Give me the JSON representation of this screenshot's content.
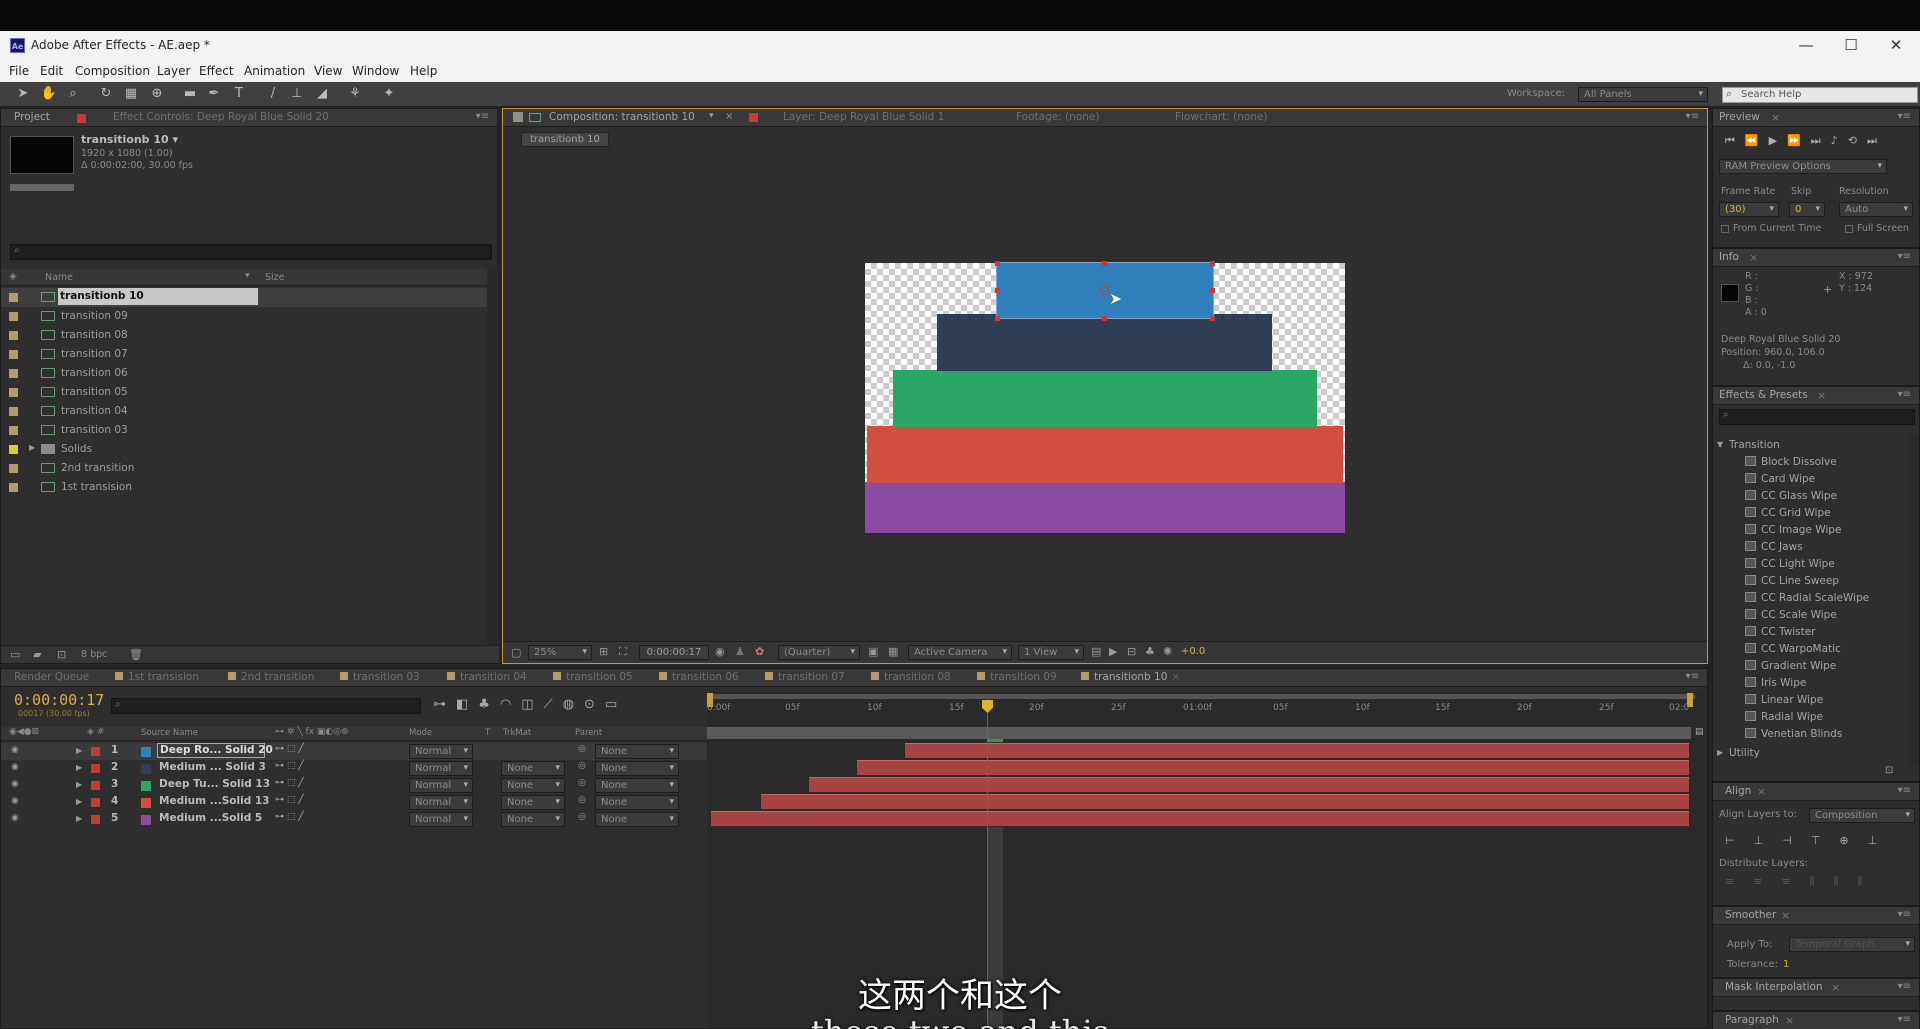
{
  "window": {
    "title": "Adobe After Effects - AE.aep *",
    "app_icon": "Ae"
  },
  "menu": [
    "File",
    "Edit",
    "Composition",
    "Layer",
    "Effect",
    "Animation",
    "View",
    "Window",
    "Help"
  ],
  "workspace": {
    "label": "Workspace:",
    "value": "All Panels"
  },
  "search_help": "Search Help",
  "project": {
    "tab_project": "Project",
    "tab_effects": "Effect Controls: Deep Royal Blue Solid 20",
    "item_name": "transitionb 10 ▾",
    "item_size": "1920 x 1080 (1.00)",
    "item_duration": "Δ 0:00:02:00, 30.00 fps",
    "col_name": "Name",
    "col_size": "Size",
    "items": [
      "transitionb 10",
      "transition 09",
      "transition 08",
      "transition 07",
      "transition 06",
      "transition 05",
      "transition 04",
      "transition 03",
      "Solids",
      "2nd transition",
      "1st transision"
    ],
    "bpc": "8 bpc"
  },
  "viewer": {
    "tab_comp": "Composition: transitionb 10",
    "tab_layer": "Layer: Deep Royal Blue Solid 1",
    "tab_footage": "Footage: (none)",
    "tab_flowchart": "Flowchart: (none)",
    "breadcrumb": "transitionb 10",
    "zoom": "25%",
    "timecode": "0:00:00:17",
    "resolution": "(Quarter)",
    "camera": "Active Camera",
    "view": "1 View",
    "exposure": "+0.0",
    "blocks": [
      {
        "name": "blue",
        "color": "#2f7fba"
      },
      {
        "name": "navy",
        "color": "#2e3f56"
      },
      {
        "name": "green",
        "color": "#2aa765"
      },
      {
        "name": "red",
        "color": "#d24f3f"
      },
      {
        "name": "purple",
        "color": "#8b4aa3"
      }
    ]
  },
  "preview": {
    "title": "Preview",
    "ram": "RAM Preview Options",
    "frame_rate": "Frame Rate",
    "skip": "Skip",
    "resolution": "Resolution",
    "frame_rate_val": "(30)",
    "skip_val": "0",
    "res_val": "Auto",
    "from_current": "From Current Time",
    "full_screen": "Full Screen"
  },
  "info": {
    "title": "Info",
    "r": "R :",
    "g": "G :",
    "b": "B :",
    "a": "A : 0",
    "x": "X : 972",
    "y": "Y : 124",
    "layer": "Deep Royal Blue Solid 20",
    "position": "Position: 960.0, 106.0",
    "delta": "Δ: 0.0, -1.0"
  },
  "effects": {
    "title": "Effects & Presets",
    "category": "Transition",
    "items": [
      "Block Dissolve",
      "Card Wipe",
      "CC Glass Wipe",
      "CC Grid Wipe",
      "CC Image Wipe",
      "CC Jaws",
      "CC Light Wipe",
      "CC Line Sweep",
      "CC Radial ScaleWipe",
      "CC Scale Wipe",
      "CC Twister",
      "CC WarpoMatic",
      "Gradient Wipe",
      "Iris Wipe",
      "Linear Wipe",
      "Radial Wipe",
      "Venetian Blinds"
    ],
    "utility": "Utility"
  },
  "align": {
    "title": "Align",
    "align_to": "Align Layers to:",
    "align_val": "Composition",
    "distribute": "Distribute Layers:"
  },
  "smoother": {
    "title": "Smoother",
    "apply_to": "Apply To:",
    "apply_val": "Temporal Graph",
    "tolerance": "Tolerance:",
    "tolerance_val": "1"
  },
  "mask_interp": "Mask Interpolation",
  "paragraph": "Paragraph",
  "timeline": {
    "tabs": [
      "Render Queue",
      "1st transision",
      "2nd transition",
      "transition 03",
      "transition 04",
      "transition 05",
      "transition 06",
      "transition 07",
      "transition 08",
      "transition 09",
      "transitionb 10"
    ],
    "timecode": "0:00:00:17",
    "fps": "00017 (30.00 fps)",
    "col_source": "Source Name",
    "col_mode": "Mode",
    "col_t": "T",
    "col_trkmat": "TrkMat",
    "col_parent": "Parent",
    "ruler": [
      "0:00f",
      "05f",
      "10f",
      "15f",
      "20f",
      "25f",
      "01:00f",
      "05f",
      "10f",
      "15f",
      "20f",
      "25f",
      "02:0"
    ],
    "layers": [
      {
        "num": "1",
        "name": "Deep Ro... Solid 20",
        "color": "#2f7fba",
        "mode": "Normal",
        "trkmat": "",
        "parent": "None"
      },
      {
        "num": "2",
        "name": "Medium ... Solid 3",
        "color": "#2e3f56",
        "mode": "Normal",
        "trkmat": "None",
        "parent": "None"
      },
      {
        "num": "3",
        "name": "Deep Tu... Solid 13",
        "color": "#2aa765",
        "mode": "Normal",
        "trkmat": "None",
        "parent": "None"
      },
      {
        "num": "4",
        "name": "Medium ...Solid 13",
        "color": "#d24f3f",
        "mode": "Normal",
        "trkmat": "None",
        "parent": "None"
      },
      {
        "num": "5",
        "name": "Medium ...Solid 5",
        "color": "#8b4aa3",
        "mode": "Normal",
        "trkmat": "None",
        "parent": "None"
      }
    ]
  },
  "subtitle": {
    "zh": "这两个和这个",
    "en": "these two and this"
  }
}
